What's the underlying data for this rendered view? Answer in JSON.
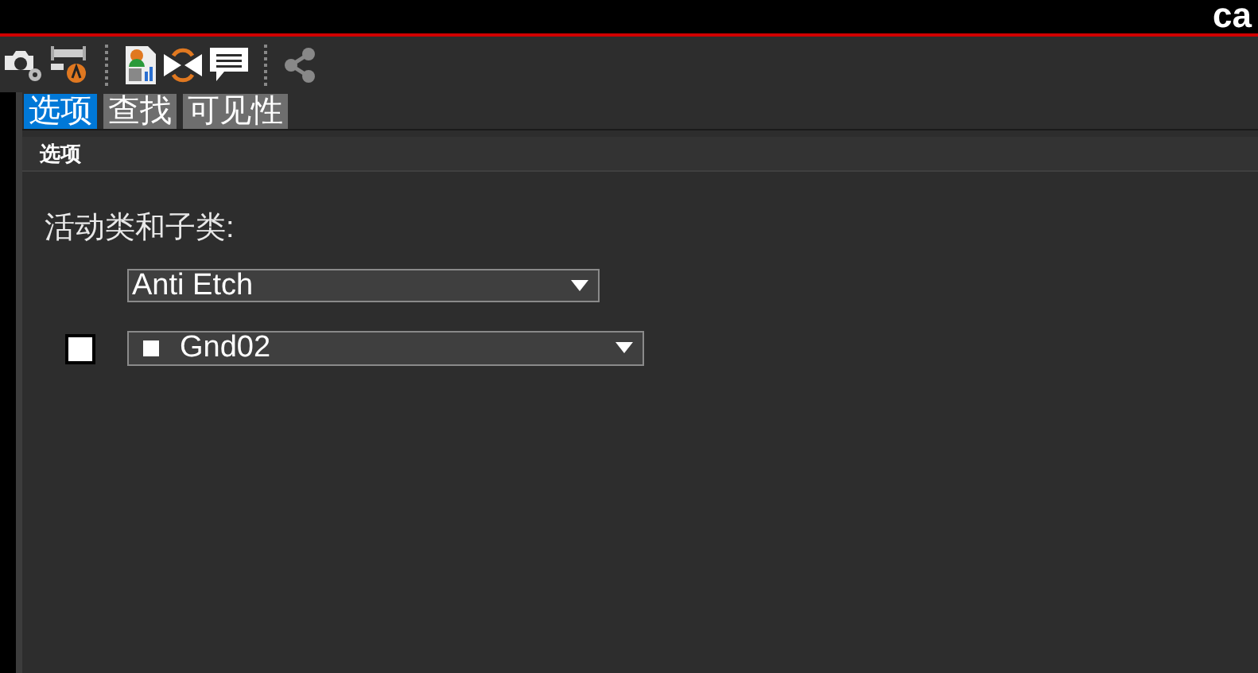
{
  "window": {
    "title": "ca"
  },
  "toolbar": [
    {
      "kind": "camera"
    },
    {
      "kind": "r2a"
    },
    {
      "kind": "separator"
    },
    {
      "kind": "report"
    },
    {
      "kind": "bowtie"
    },
    {
      "kind": "comment"
    },
    {
      "kind": "separator"
    },
    {
      "kind": "share"
    }
  ],
  "tabs": [
    {
      "label": "选项",
      "selected": true
    },
    {
      "label": "查找",
      "selected": false
    },
    {
      "label": "可见性",
      "selected": false
    }
  ],
  "panel": {
    "title": "选项",
    "label": "活动类和子类:",
    "class_dropdown": {
      "value": "Anti Etch"
    },
    "subclass": {
      "checked": false,
      "value": "Gnd02",
      "color": "#ffffff"
    }
  }
}
